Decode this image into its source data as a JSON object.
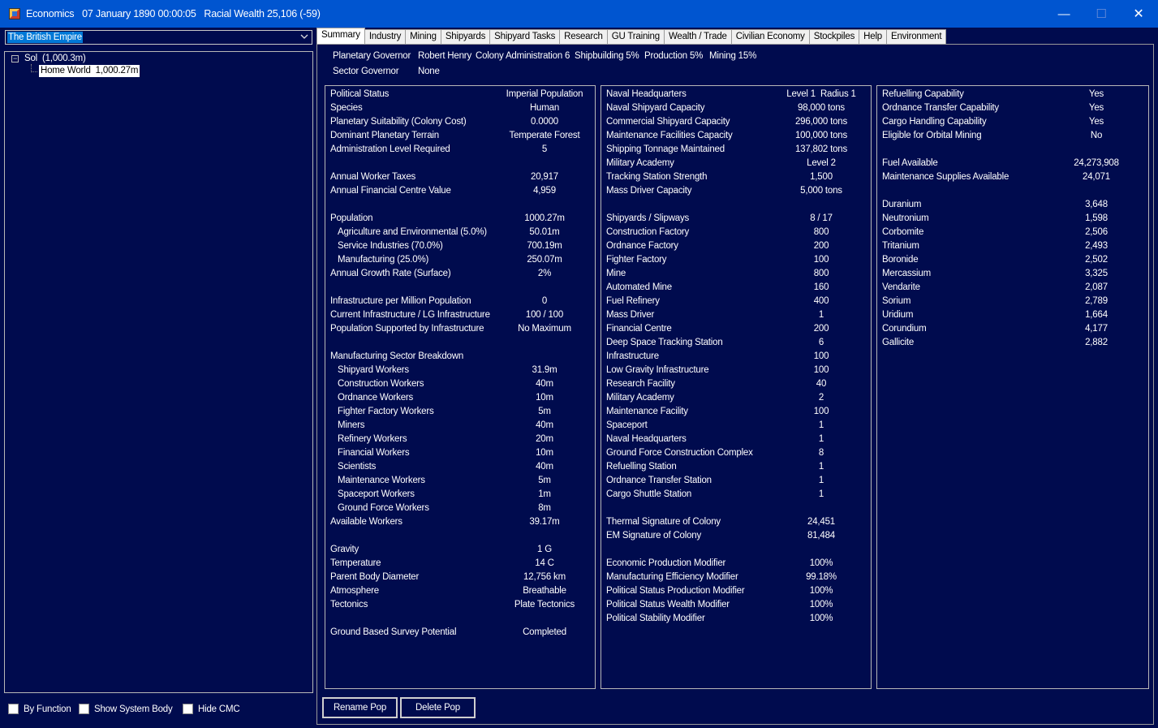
{
  "window": {
    "title": "Economics   07 January 1890 00:00:05   Racial Wealth 25,106 (-59)",
    "minimize_glyph": "—",
    "maximize_glyph": "☐",
    "close_glyph": "✕"
  },
  "left": {
    "race_selected": "The British Empire",
    "tree": {
      "expander": "−",
      "system": "Sol  (1,000.3m)",
      "body": "Home World  1,000.27m"
    },
    "checkboxes": [
      {
        "label": "By Function",
        "checked": false
      },
      {
        "label": "Show System Body",
        "checked": false
      },
      {
        "label": "Hide CMC",
        "checked": false
      }
    ]
  },
  "tabs": [
    "Summary",
    "Industry",
    "Mining",
    "Shipyards",
    "Shipyard Tasks",
    "Research",
    "GU Training",
    "Wealth / Trade",
    "Civilian Economy",
    "Stockpiles",
    "Help",
    "Environment"
  ],
  "active_tab": "Summary",
  "governors": {
    "planetary_label": "Planetary Governor",
    "planetary_name": "Robert Henry",
    "bonuses": [
      "Colony Administration 6",
      "Shipbuilding 5%",
      "Production 5%",
      "Mining 15%"
    ],
    "sector_label": "Sector Governor",
    "sector_name": "None"
  },
  "col1": [
    {
      "label": "Political Status",
      "value": "Imperial Population"
    },
    {
      "label": "Species",
      "value": "Human"
    },
    {
      "label": "Planetary Suitability (Colony Cost)",
      "value": "0.0000"
    },
    {
      "label": "Dominant Planetary Terrain",
      "value": "Temperate Forest"
    },
    {
      "label": "Administration Level Required",
      "value": "5"
    },
    {
      "label": "",
      "value": ""
    },
    {
      "label": "Annual Worker Taxes",
      "value": "20,917"
    },
    {
      "label": "Annual Financial Centre Value",
      "value": "4,959"
    },
    {
      "label": "",
      "value": ""
    },
    {
      "label": "Population",
      "value": "1000.27m"
    },
    {
      "label": "Agriculture and Environmental (5.0%)",
      "value": "50.01m",
      "indent": true
    },
    {
      "label": "Service Industries (70.0%)",
      "value": "700.19m",
      "indent": true
    },
    {
      "label": "Manufacturing (25.0%)",
      "value": "250.07m",
      "indent": true
    },
    {
      "label": "Annual Growth Rate (Surface)",
      "value": "2%"
    },
    {
      "label": "",
      "value": ""
    },
    {
      "label": "Infrastructure per Million Population",
      "value": "0"
    },
    {
      "label": "Current Infrastructure / LG Infrastructure",
      "value": "100 / 100"
    },
    {
      "label": "Population Supported by Infrastructure",
      "value": "No Maximum"
    },
    {
      "label": "",
      "value": ""
    },
    {
      "label": "Manufacturing Sector Breakdown",
      "value": ""
    },
    {
      "label": "Shipyard Workers",
      "value": "31.9m",
      "indent": true
    },
    {
      "label": "Construction Workers",
      "value": "40m",
      "indent": true
    },
    {
      "label": "Ordnance Workers",
      "value": "10m",
      "indent": true
    },
    {
      "label": "Fighter Factory Workers",
      "value": "5m",
      "indent": true
    },
    {
      "label": "Miners",
      "value": "40m",
      "indent": true
    },
    {
      "label": "Refinery Workers",
      "value": "20m",
      "indent": true
    },
    {
      "label": "Financial Workers",
      "value": "10m",
      "indent": true
    },
    {
      "label": "Scientists",
      "value": "40m",
      "indent": true
    },
    {
      "label": "Maintenance Workers",
      "value": "5m",
      "indent": true
    },
    {
      "label": "Spaceport Workers",
      "value": "1m",
      "indent": true
    },
    {
      "label": "Ground Force Workers",
      "value": "8m",
      "indent": true
    },
    {
      "label": "Available Workers",
      "value": "39.17m"
    },
    {
      "label": "",
      "value": ""
    },
    {
      "label": "Gravity",
      "value": "1 G"
    },
    {
      "label": "Temperature",
      "value": "14 C"
    },
    {
      "label": "Parent Body Diameter",
      "value": "12,756 km"
    },
    {
      "label": "Atmosphere",
      "value": "Breathable"
    },
    {
      "label": "Tectonics",
      "value": "Plate Tectonics"
    },
    {
      "label": "",
      "value": ""
    },
    {
      "label": "Ground Based Survey Potential",
      "value": "Completed"
    }
  ],
  "col2": [
    {
      "label": "Naval Headquarters",
      "value": "Level 1  Radius 1"
    },
    {
      "label": "Naval Shipyard Capacity",
      "value": "98,000 tons"
    },
    {
      "label": "Commercial Shipyard Capacity",
      "value": "296,000 tons"
    },
    {
      "label": "Maintenance Facilities Capacity",
      "value": "100,000 tons"
    },
    {
      "label": "Shipping Tonnage Maintained",
      "value": "137,802 tons"
    },
    {
      "label": "Military Academy",
      "value": "Level 2"
    },
    {
      "label": "Tracking Station Strength",
      "value": "1,500"
    },
    {
      "label": "Mass Driver Capacity",
      "value": "5,000 tons"
    },
    {
      "label": "",
      "value": ""
    },
    {
      "label": "Shipyards / Slipways",
      "value": "8 / 17"
    },
    {
      "label": "Construction Factory",
      "value": "800"
    },
    {
      "label": "Ordnance Factory",
      "value": "200"
    },
    {
      "label": "Fighter Factory",
      "value": "100"
    },
    {
      "label": "Mine",
      "value": "800"
    },
    {
      "label": "Automated Mine",
      "value": "160"
    },
    {
      "label": "Fuel Refinery",
      "value": "400"
    },
    {
      "label": "Mass Driver",
      "value": "1"
    },
    {
      "label": "Financial Centre",
      "value": "200"
    },
    {
      "label": "Deep Space Tracking Station",
      "value": "6"
    },
    {
      "label": "Infrastructure",
      "value": "100"
    },
    {
      "label": "Low Gravity Infrastructure",
      "value": "100"
    },
    {
      "label": "Research Facility",
      "value": "40"
    },
    {
      "label": "Military Academy",
      "value": "2"
    },
    {
      "label": "Maintenance Facility",
      "value": "100"
    },
    {
      "label": "Spaceport",
      "value": "1"
    },
    {
      "label": "Naval Headquarters",
      "value": "1"
    },
    {
      "label": "Ground Force Construction Complex",
      "value": "8"
    },
    {
      "label": "Refuelling Station",
      "value": "1"
    },
    {
      "label": "Ordnance Transfer Station",
      "value": "1"
    },
    {
      "label": "Cargo Shuttle Station",
      "value": "1"
    },
    {
      "label": "",
      "value": ""
    },
    {
      "label": "Thermal Signature of Colony",
      "value": "24,451"
    },
    {
      "label": "EM Signature of Colony",
      "value": "81,484"
    },
    {
      "label": "",
      "value": ""
    },
    {
      "label": "Economic Production Modifier",
      "value": "100%"
    },
    {
      "label": "Manufacturing Efficiency Modifier",
      "value": "99.18%"
    },
    {
      "label": "Political Status Production Modifier",
      "value": "100%"
    },
    {
      "label": "Political Status Wealth Modifier",
      "value": "100%"
    },
    {
      "label": "Political Stability Modifier",
      "value": "100%"
    }
  ],
  "col3": [
    {
      "label": "Refuelling Capability",
      "value": "Yes"
    },
    {
      "label": "Ordnance Transfer Capability",
      "value": "Yes"
    },
    {
      "label": "Cargo Handling Capability",
      "value": "Yes"
    },
    {
      "label": "Eligible for Orbital Mining",
      "value": "No"
    },
    {
      "label": "",
      "value": ""
    },
    {
      "label": "Fuel Available",
      "value": "24,273,908"
    },
    {
      "label": "Maintenance Supplies Available",
      "value": "24,071"
    },
    {
      "label": "",
      "value": ""
    },
    {
      "label": "Duranium",
      "value": "3,648"
    },
    {
      "label": "Neutronium",
      "value": "1,598"
    },
    {
      "label": "Corbomite",
      "value": "2,506"
    },
    {
      "label": "Tritanium",
      "value": "2,493"
    },
    {
      "label": "Boronide",
      "value": "2,502"
    },
    {
      "label": "Mercassium",
      "value": "3,325"
    },
    {
      "label": "Vendarite",
      "value": "2,087"
    },
    {
      "label": "Sorium",
      "value": "2,789"
    },
    {
      "label": "Uridium",
      "value": "1,664"
    },
    {
      "label": "Corundium",
      "value": "4,177"
    },
    {
      "label": "Gallicite",
      "value": "2,882"
    }
  ],
  "buttons": {
    "rename": "Rename Pop",
    "delete": "Delete Pop"
  }
}
